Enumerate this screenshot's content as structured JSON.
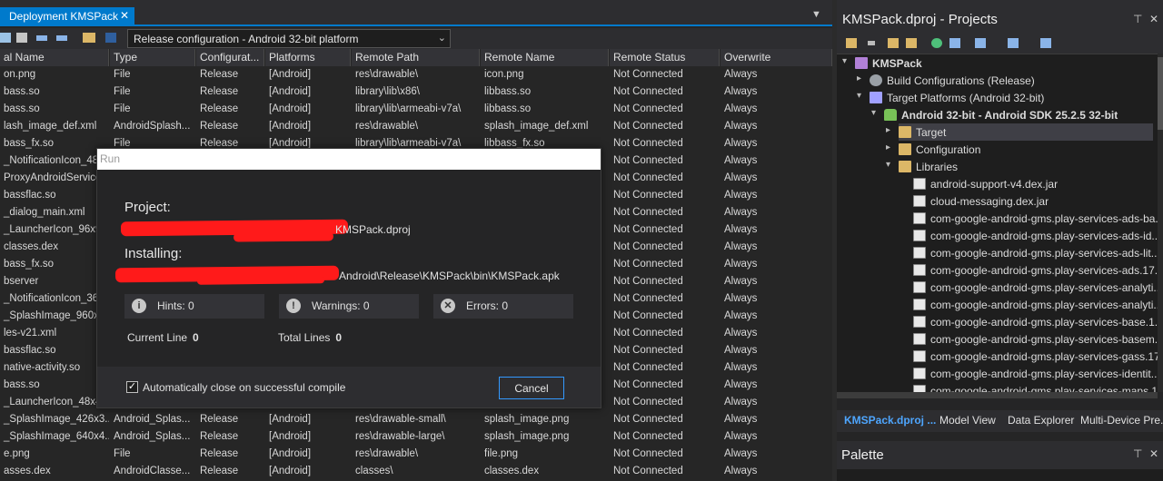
{
  "tab": {
    "title": "Deployment KMSPack",
    "close": "✕"
  },
  "toolbar": {
    "config_select": "Release configuration - Android 32-bit platform"
  },
  "grid": {
    "headers": [
      "al Name",
      "Type",
      "Configurat...",
      "Platforms",
      "Remote Path",
      "Remote Name",
      "Remote Status",
      "Overwrite"
    ],
    "rows": [
      [
        "on.png",
        "File",
        "Release",
        "[Android]",
        "res\\drawable\\",
        "icon.png",
        "Not Connected",
        "Always"
      ],
      [
        "bass.so",
        "File",
        "Release",
        "[Android]",
        "library\\lib\\x86\\",
        "libbass.so",
        "Not Connected",
        "Always"
      ],
      [
        "bass.so",
        "File",
        "Release",
        "[Android]",
        "library\\lib\\armeabi-v7a\\",
        "libbass.so",
        "Not Connected",
        "Always"
      ],
      [
        "lash_image_def.xml",
        "AndroidSplash...",
        "Release",
        "[Android]",
        "res\\drawable\\",
        "splash_image_def.xml",
        "Not Connected",
        "Always"
      ],
      [
        "bass_fx.so",
        "File",
        "Release",
        "[Android]",
        "library\\lib\\armeabi-v7a\\",
        "libbass_fx.so",
        "Not Connected",
        "Always"
      ],
      [
        "_NotificationIcon_48...",
        "",
        "",
        "",
        "",
        "",
        "Not Connected",
        "Always"
      ],
      [
        "ProxyAndroidService...",
        "",
        "",
        "",
        "",
        "",
        "Not Connected",
        "Always"
      ],
      [
        "bassflac.so",
        "",
        "",
        "",
        "",
        "",
        "Not Connected",
        "Always"
      ],
      [
        "_dialog_main.xml",
        "",
        "",
        "",
        "",
        "",
        "Not Connected",
        "Always"
      ],
      [
        "_LauncherIcon_96x9...",
        "",
        "",
        "",
        "",
        "",
        "Not Connected",
        "Always"
      ],
      [
        "classes.dex",
        "",
        "",
        "",
        "",
        "",
        "Not Connected",
        "Always"
      ],
      [
        "bass_fx.so",
        "",
        "",
        "",
        "",
        "",
        "Not Connected",
        "Always"
      ],
      [
        "bserver",
        "",
        "",
        "",
        "",
        "",
        "Not Connected",
        "Always"
      ],
      [
        "_NotificationIcon_36...",
        "",
        "",
        "",
        "",
        "",
        "Not Connected",
        "Always"
      ],
      [
        "_SplashImage_960x7...",
        "",
        "",
        "",
        "",
        "",
        "Not Connected",
        "Always"
      ],
      [
        "les-v21.xml",
        "",
        "",
        "",
        "",
        "",
        "Not Connected",
        "Always"
      ],
      [
        "bassflac.so",
        "",
        "",
        "",
        "",
        "",
        "Not Connected",
        "Always"
      ],
      [
        "native-activity.so",
        "",
        "",
        "",
        "",
        "",
        "Not Connected",
        "Always"
      ],
      [
        "bass.so",
        "",
        "",
        "",
        "",
        "",
        "Not Connected",
        "Always"
      ],
      [
        "_LauncherIcon_48x4...",
        "",
        "",
        "",
        "",
        "",
        "Not Connected",
        "Always"
      ],
      [
        "_SplashImage_426x3...",
        "Android_Splas...",
        "Release",
        "[Android]",
        "res\\drawable-small\\",
        "splash_image.png",
        "Not Connected",
        "Always"
      ],
      [
        "_SplashImage_640x4...",
        "Android_Splas...",
        "Release",
        "[Android]",
        "res\\drawable-large\\",
        "splash_image.png",
        "Not Connected",
        "Always"
      ],
      [
        "e.png",
        "File",
        "Release",
        "[Android]",
        "res\\drawable\\",
        "file.png",
        "Not Connected",
        "Always"
      ],
      [
        "asses.dex",
        "AndroidClasse...",
        "Release",
        "[Android]",
        "classes\\",
        "classes.dex",
        "Not Connected",
        "Always"
      ]
    ]
  },
  "dialog": {
    "title": "Run",
    "project_label": "Project:",
    "project_value": "KMSPack.dproj",
    "installing_label": "Installing:",
    "installing_value": "Android\\Release\\KMSPack\\bin\\KMSPack.apk",
    "hints": "Hints:  0",
    "warnings": "Warnings:  0",
    "errors": "Errors:  0",
    "current_line_label": "Current Line",
    "current_line_value": "0",
    "total_lines_label": "Total Lines",
    "total_lines_value": "0",
    "auto_close_label": "Automatically close on successful compile",
    "auto_close_checked": true,
    "cancel": "Cancel"
  },
  "projects": {
    "title": "KMSPack.dproj - Projects",
    "tree": [
      {
        "label": "KMSPack",
        "bold": true,
        "icon": "project-icon"
      },
      {
        "label": "Build Configurations (Release)",
        "bold": false,
        "icon": "gear-icon"
      },
      {
        "label": "Target Platforms (Android 32-bit)",
        "bold": false,
        "icon": "platform-icon"
      },
      {
        "label": "Android 32-bit - Android SDK 25.2.5 32-bit",
        "bold": true,
        "icon": "android-icon"
      },
      {
        "label": "Target",
        "bold": false,
        "icon": "folder-icon"
      },
      {
        "label": "Configuration",
        "bold": false,
        "icon": "folder-icon"
      },
      {
        "label": "Libraries",
        "bold": false,
        "icon": "folder-icon"
      },
      {
        "label": "android-support-v4.dex.jar",
        "bold": false,
        "icon": "file-icon"
      },
      {
        "label": "cloud-messaging.dex.jar",
        "bold": false,
        "icon": "file-icon"
      },
      {
        "label": "com-google-android-gms.play-services-ads-ba...",
        "bold": false,
        "icon": "file-icon"
      },
      {
        "label": "com-google-android-gms.play-services-ads-id...",
        "bold": false,
        "icon": "file-icon"
      },
      {
        "label": "com-google-android-gms.play-services-ads-lit...",
        "bold": false,
        "icon": "file-icon"
      },
      {
        "label": "com-google-android-gms.play-services-ads.17....",
        "bold": false,
        "icon": "file-icon"
      },
      {
        "label": "com-google-android-gms.play-services-analyti...",
        "bold": false,
        "icon": "file-icon"
      },
      {
        "label": "com-google-android-gms.play-services-analyti...",
        "bold": false,
        "icon": "file-icon"
      },
      {
        "label": "com-google-android-gms.play-services-base.1...",
        "bold": false,
        "icon": "file-icon"
      },
      {
        "label": "com-google-android-gms.play-services-basem...",
        "bold": false,
        "icon": "file-icon"
      },
      {
        "label": "com-google-android-gms.play-services-gass.17....",
        "bold": false,
        "icon": "file-icon"
      },
      {
        "label": "com-google-android-gms.play-services-identit...",
        "bold": false,
        "icon": "file-icon"
      },
      {
        "label": "com-google-android-gms.play-services-maps.1...",
        "bold": false,
        "icon": "file-icon"
      }
    ],
    "bottom_tabs": [
      "KMSPack.dproj ...",
      "Model View",
      "Data Explorer",
      "Multi-Device Pre..."
    ]
  },
  "palette": {
    "title": "Palette"
  },
  "colors": {
    "accent": "#007acc",
    "redaction": "#ff1a1a"
  }
}
